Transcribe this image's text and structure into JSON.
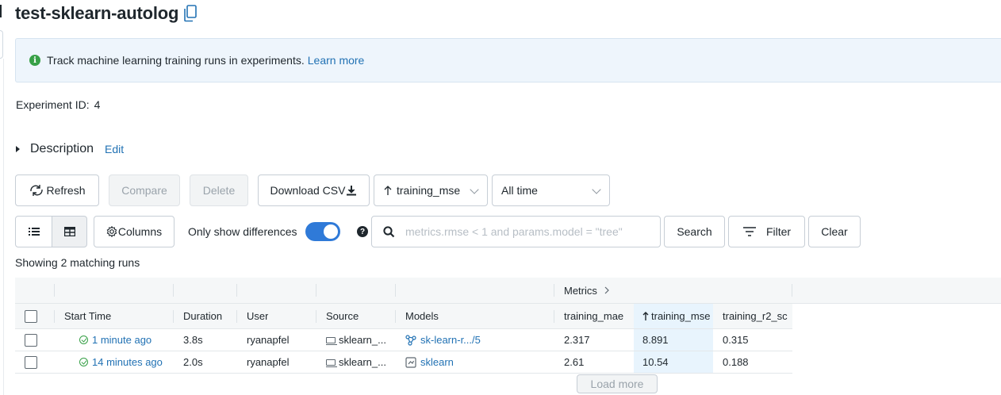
{
  "title": "test-sklearn-autolog",
  "banner": {
    "text": "Track machine learning training runs in experiments.",
    "link": "Learn more"
  },
  "experiment": {
    "label": "Experiment ID:",
    "id": "4"
  },
  "description": {
    "label": "Description",
    "edit": "Edit"
  },
  "toolbar": {
    "refresh": "Refresh",
    "compare": "Compare",
    "delete": "Delete",
    "download": "Download CSV",
    "sort": "training_mse",
    "time_range": "All time",
    "columns": "Columns",
    "only_diff": "Only show differences",
    "only_diff_on": true,
    "search_placeholder": "metrics.rmse < 1 and params.model = \"tree\"",
    "search": "Search",
    "filter": "Filter",
    "clear": "Clear"
  },
  "showing": "Showing 2 matching runs",
  "table": {
    "group_header": "Metrics",
    "columns": [
      "Start Time",
      "Duration",
      "User",
      "Source",
      "Models",
      "training_mae",
      "training_mse",
      "training_r2_sc"
    ],
    "rows": [
      {
        "start": "1 minute ago",
        "duration": "3.8s",
        "user": "ryanapfel",
        "source": "sklearn_...",
        "model": "sk-learn-r.../5",
        "mae": "2.317",
        "mse": "8.891",
        "r2": "0.315"
      },
      {
        "start": "14 minutes ago",
        "duration": "2.0s",
        "user": "ryanapfel",
        "source": "sklearn_...",
        "model": "sklearn",
        "mae": "2.61",
        "mse": "10.54",
        "r2": "0.188"
      }
    ]
  },
  "load_more": "Load more",
  "colors": {
    "accent": "#2272b4",
    "toggle": "#2f7ad8",
    "success": "#37a047",
    "banner_bg": "#eef5fc",
    "sorted_col": "#e8f4fd"
  }
}
